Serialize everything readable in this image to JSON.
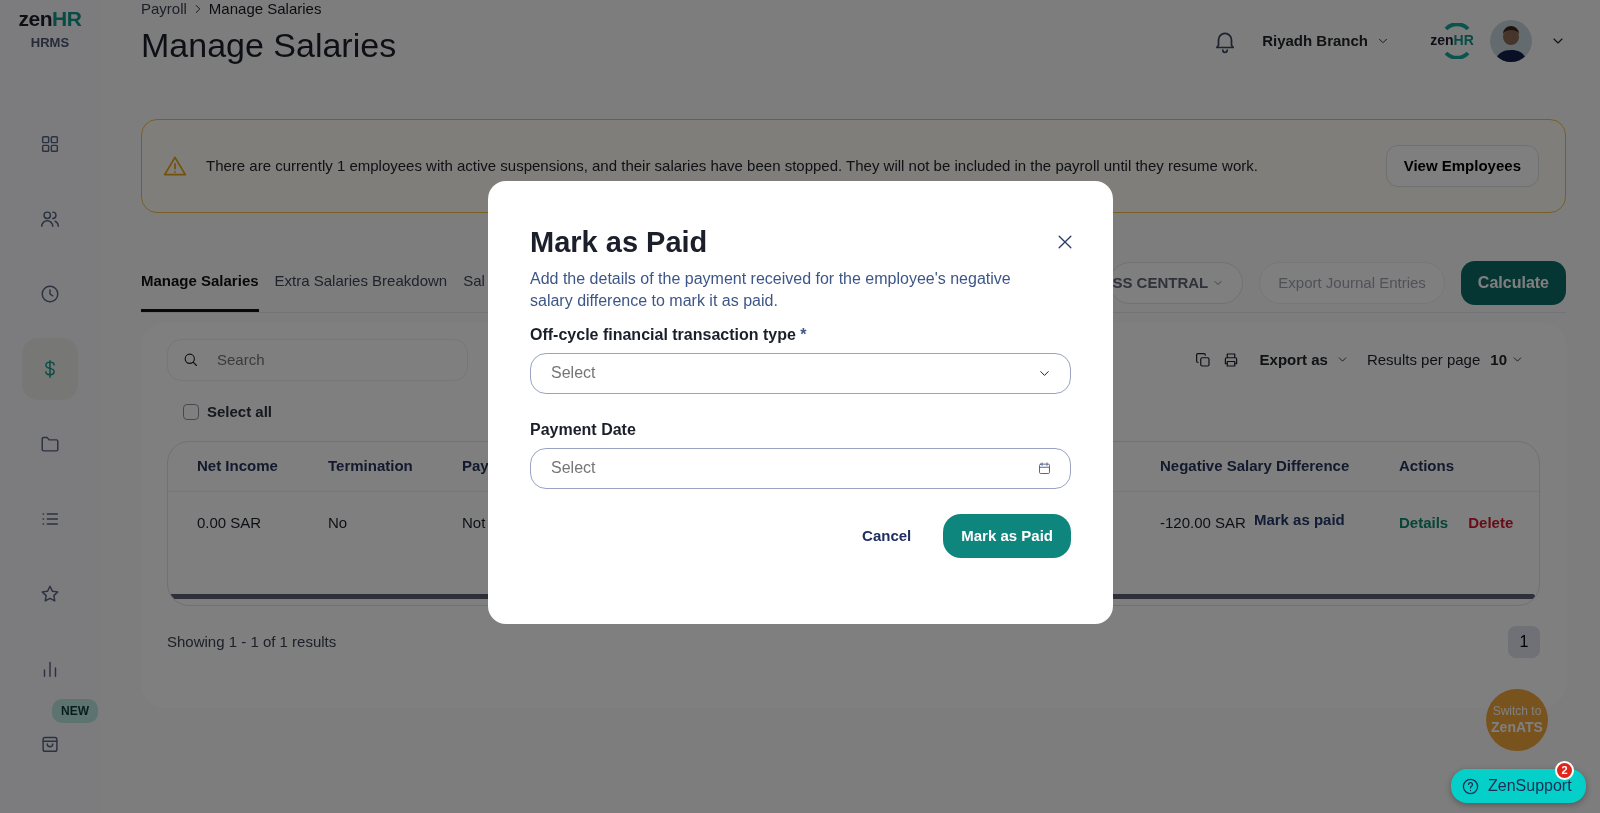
{
  "sidebar": {
    "logo": {
      "brand": "zen",
      "accent": "HR",
      "product": "HRMS"
    },
    "items": [
      {
        "selected": false
      },
      {
        "selected": false
      },
      {
        "selected": false
      },
      {
        "selected": true
      },
      {
        "selected": false
      },
      {
        "selected": false
      },
      {
        "selected": false
      },
      {
        "selected": false
      },
      {
        "selected": false,
        "badge": "NEW"
      }
    ]
  },
  "header": {
    "breadcrumb": [
      "Payroll",
      "Manage Salaries"
    ],
    "title": "Manage Salaries",
    "branch": "Riyadh Branch",
    "company_logo": {
      "brand": "zen",
      "accent": "HR"
    }
  },
  "alert": {
    "text": "There are currently 1 employees with active suspensions, and their salaries have been stopped. They will not be included in the payroll until they resume work.",
    "button": "View Employees"
  },
  "tabs": [
    {
      "label": "Manage Salaries",
      "selected": true
    },
    {
      "label": "Extra Salaries Breakdown",
      "selected": false
    },
    {
      "label": "Sal",
      "selected": false
    }
  ],
  "actions": {
    "selector": "SS CENTRAL",
    "export_journal": {
      "label": "Export Journal Entries",
      "disabled": true
    },
    "calculate": "Calculate"
  },
  "toolbar": {
    "search_placeholder": "Search",
    "select_all": {
      "label": "Select all",
      "checked": false
    },
    "export": "Export as",
    "results_label": "Results per page",
    "results_value": "10"
  },
  "table": {
    "columns": [
      "Net Income",
      "Termination",
      "Pay",
      "Negative Salary Difference",
      "Actions"
    ],
    "rows": [
      {
        "net_income": "0.00 SAR",
        "termination": "No",
        "column_3": "Not",
        "negative_salary_difference": {
          "amount": "-120.00 SAR",
          "link": "Mark as paid"
        },
        "actions": [
          {
            "label": "Details",
            "kind": "details"
          },
          {
            "label": "Delete",
            "kind": "delete"
          }
        ]
      }
    ]
  },
  "footer": {
    "summary": "Showing 1 - 1 of 1 results",
    "pages": [
      {
        "label": "1",
        "selected": true
      }
    ]
  },
  "modal": {
    "title": "Mark as Paid",
    "description": "Add the details of the payment received for the employee's negative salary difference to mark it as paid.",
    "fields": [
      {
        "kind": "select",
        "label": "Off-cycle financial transaction type",
        "asterisk": "*",
        "placeholder": "Select"
      },
      {
        "kind": "date",
        "label": "Payment Date",
        "placeholder": "Select"
      }
    ],
    "cancel": "Cancel",
    "submit": "Mark as Paid"
  },
  "floating": {
    "switch": {
      "line1": "Switch to",
      "line2": "ZenATS"
    },
    "support": {
      "label": "ZenSupport",
      "badge": "2"
    }
  }
}
